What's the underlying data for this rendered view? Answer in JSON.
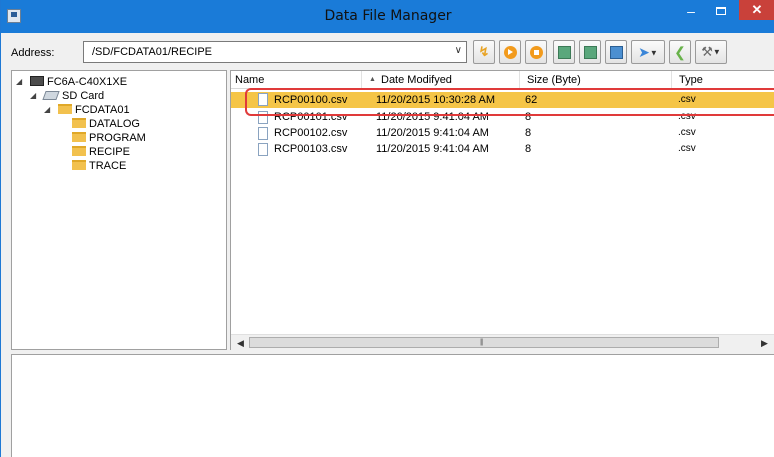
{
  "window": {
    "title": "Data File Manager",
    "minimize_label": "–",
    "close_label": "✕"
  },
  "address_bar": {
    "label": "Address:",
    "value": "/SD/FCDATA01/RECIPE"
  },
  "toolbar": {
    "icons": [
      "lightning-icon",
      "run-icon",
      "stop-icon",
      "upload-icon",
      "download-icon",
      "transfer-icon",
      "back-arrow-icon",
      "forward-arrow-icon",
      "tools-icon"
    ]
  },
  "tree": {
    "root": "FC6A-C40X1XE",
    "sd_card": "SD Card",
    "fcdata": "FCDATA01",
    "folders": [
      "DATALOG",
      "PROGRAM",
      "RECIPE",
      "TRACE"
    ]
  },
  "file_list": {
    "columns": {
      "name": "Name",
      "date": "Date Modifyed",
      "size": "Size (Byte)",
      "type": "Type"
    },
    "rows": [
      {
        "name": "RCP00100.csv",
        "date": "11/20/2015 10:30:28 AM",
        "size": "62",
        "type": ".csv",
        "selected": true
      },
      {
        "name": "RCP00101.csv",
        "date": "11/20/2015 9:41:04 AM",
        "size": "8",
        "type": ".csv",
        "selected": false
      },
      {
        "name": "RCP00102.csv",
        "date": "11/20/2015 9:41:04 AM",
        "size": "8",
        "type": ".csv",
        "selected": false
      },
      {
        "name": "RCP00103.csv",
        "date": "11/20/2015 9:41:04 AM",
        "size": "8",
        "type": ".csv",
        "selected": false
      }
    ]
  },
  "colors": {
    "titlebar": "#1a7bd8",
    "selection": "#f5c547",
    "highlight_box": "#e03a3a",
    "close_button": "#c9413a"
  }
}
